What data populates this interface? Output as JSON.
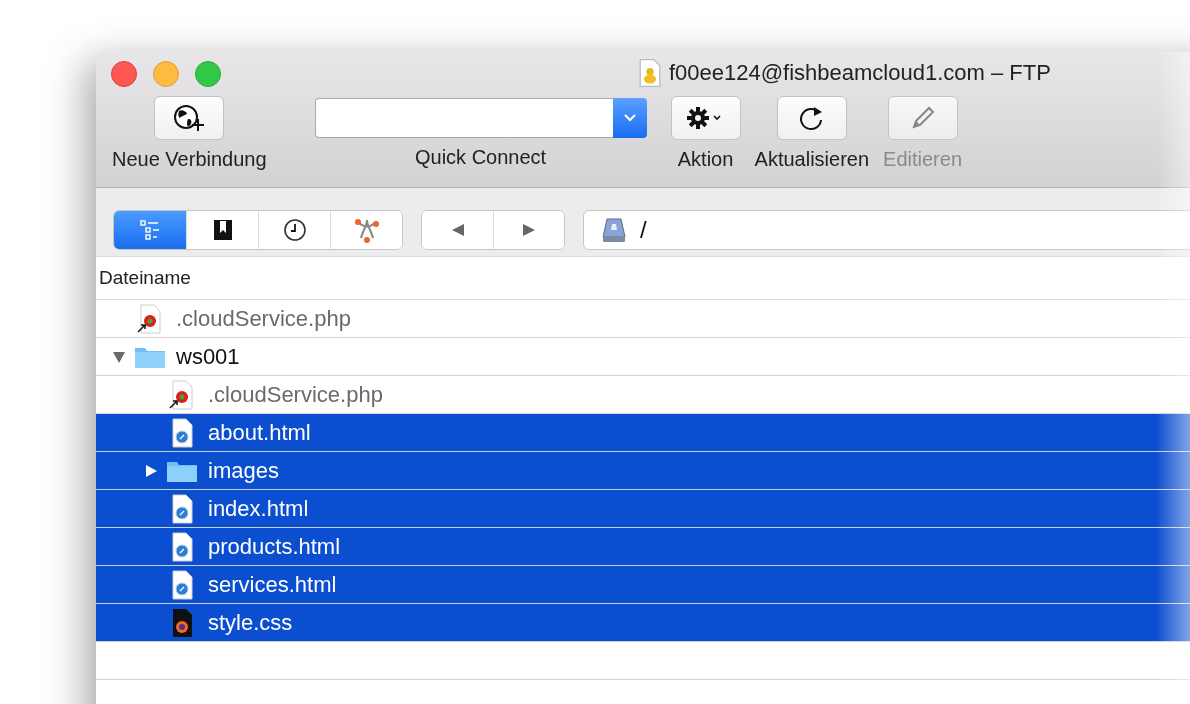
{
  "window": {
    "title": "f00ee124@fishbeamcloud1.com – FTP"
  },
  "toolbar": [
    {
      "kind": "new-connection",
      "label": "Neue Verbindung",
      "disabled": false
    },
    {
      "kind": "quick-connect",
      "label": "Quick Connect",
      "disabled": false
    },
    {
      "kind": "action",
      "label": "Aktion",
      "disabled": false
    },
    {
      "kind": "refresh",
      "label": "Aktualisieren",
      "disabled": false
    },
    {
      "kind": "edit",
      "label": "Editieren",
      "disabled": true
    }
  ],
  "view_tabs": [
    {
      "kind": "browser",
      "selected": true
    },
    {
      "kind": "bookmarks",
      "selected": false
    },
    {
      "kind": "history",
      "selected": false
    },
    {
      "kind": "bonjour",
      "selected": false
    }
  ],
  "path": {
    "value": "/"
  },
  "column": "Dateiname",
  "rows": [
    {
      "kind": "php",
      "name": ".cloudService.php",
      "hidden": true,
      "selected": false
    },
    {
      "kind": "folder",
      "name": "ws001",
      "hidden": false,
      "selected": false,
      "expanded": true,
      "children": [
        {
          "kind": "php",
          "name": ".cloudService.php",
          "hidden": true,
          "selected": false
        },
        {
          "kind": "html",
          "name": "about.html",
          "hidden": false,
          "selected": true
        },
        {
          "kind": "folder",
          "name": "images",
          "hidden": false,
          "selected": true,
          "expanded": false
        },
        {
          "kind": "html",
          "name": "index.html",
          "hidden": false,
          "selected": true
        },
        {
          "kind": "html",
          "name": "products.html",
          "hidden": false,
          "selected": true
        },
        {
          "kind": "html",
          "name": "services.html",
          "hidden": false,
          "selected": true
        },
        {
          "kind": "css",
          "name": "style.css",
          "hidden": false,
          "selected": true
        }
      ]
    }
  ]
}
